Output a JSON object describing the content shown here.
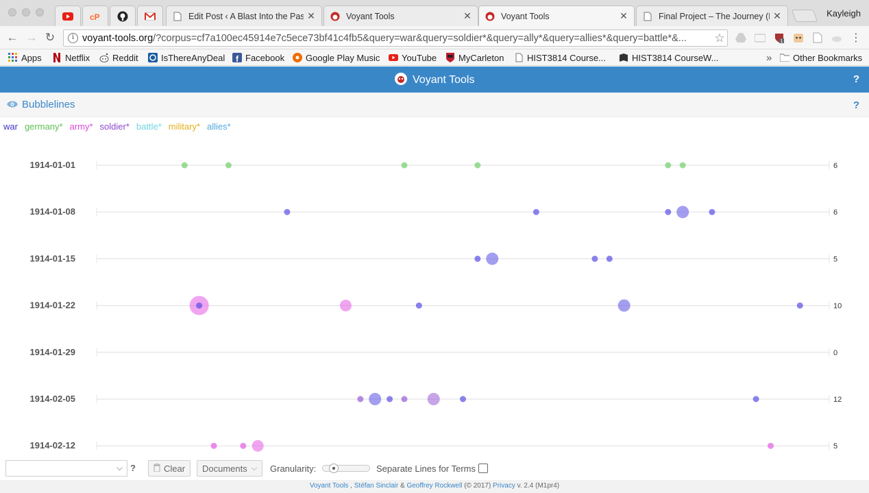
{
  "browser": {
    "tabs": [
      {
        "title": "",
        "favicon": "youtube-icon",
        "pinned": true
      },
      {
        "title": "",
        "favicon": "cpanel-icon",
        "pinned": true
      },
      {
        "title": "",
        "favicon": "github-icon",
        "pinned": true
      },
      {
        "title": "",
        "favicon": "gmail-icon",
        "pinned": true
      },
      {
        "title": "Edit Post ‹ A Blast Into the Pas",
        "favicon": "page-icon",
        "pinned": false
      },
      {
        "title": "Voyant Tools",
        "favicon": "voyant-icon",
        "pinned": false
      },
      {
        "title": "Voyant Tools",
        "favicon": "voyant-icon",
        "pinned": false,
        "active": true
      },
      {
        "title": "Final Project – The Journey (No",
        "favicon": "page-icon",
        "pinned": false
      }
    ],
    "profile_name": "Kayleigh",
    "url_domain": "voyant-tools.org",
    "url_rest": "/?corpus=cf7a100ec45914e7c5ece73bf41c4fb5&query=war&query=soldier*&query=ally*&query=allies*&query=battle*&..."
  },
  "bookmarks": [
    {
      "label": "Apps",
      "icon": "apps-grid-icon"
    },
    {
      "label": "Netflix",
      "icon": "netflix-icon"
    },
    {
      "label": "Reddit",
      "icon": "reddit-icon"
    },
    {
      "label": "IsThereAnyDeal",
      "icon": "isthereanydeal-icon"
    },
    {
      "label": "Facebook",
      "icon": "facebook-icon"
    },
    {
      "label": "Google Play Music",
      "icon": "play-music-icon"
    },
    {
      "label": "YouTube",
      "icon": "youtube-icon"
    },
    {
      "label": "MyCarleton",
      "icon": "carleton-icon"
    },
    {
      "label": "HIST3814 Course...",
      "icon": "page-icon"
    },
    {
      "label": "HIST3814 CourseW...",
      "icon": "book-icon"
    }
  ],
  "bookmarks_overflow": "»",
  "other_bookmarks": "Other Bookmarks",
  "app": {
    "title": "Voyant Tools",
    "help": "?"
  },
  "panel": {
    "title": "Bubblelines",
    "help": "?"
  },
  "colors": {
    "header_blue": "#3a87c8",
    "war": "#5a4ee6",
    "germany": "#72cf6b",
    "army": "#e45be4",
    "soldier": "#9a5ad6",
    "battle": "#7fe0ee",
    "military": "#e7b71f",
    "allies": "#5cb6e6"
  },
  "legend": [
    {
      "term": "war",
      "color": "#3f32c8"
    },
    {
      "term": "germany*",
      "color": "#5dbf55"
    },
    {
      "term": "army*",
      "color": "#d84bd8"
    },
    {
      "term": "soldier*",
      "color": "#8e49cc"
    },
    {
      "term": "battle*",
      "color": "#6fd6e6"
    },
    {
      "term": "military*",
      "color": "#e2b01a"
    },
    {
      "term": "allies*",
      "color": "#4fa9dc"
    }
  ],
  "chart_data": {
    "type": "scatter",
    "description_note": "",
    "documents": [
      {
        "label": "1914-01-01",
        "count": "6",
        "bubbles": [
          {
            "pos": 0.12,
            "term": "germany*",
            "r": 4.5
          },
          {
            "pos": 0.18,
            "term": "germany*",
            "r": 4.5
          },
          {
            "pos": 0.42,
            "term": "germany*",
            "r": 4.5
          },
          {
            "pos": 0.52,
            "term": "germany*",
            "r": 4.5
          },
          {
            "pos": 0.78,
            "term": "germany*",
            "r": 4.5
          },
          {
            "pos": 0.8,
            "term": "germany*",
            "r": 4.5
          }
        ]
      },
      {
        "label": "1914-01-08",
        "count": "6",
        "bubbles": [
          {
            "pos": 0.26,
            "term": "war",
            "r": 4.5
          },
          {
            "pos": 0.6,
            "term": "war",
            "r": 4.5
          },
          {
            "pos": 0.78,
            "term": "war",
            "r": 4.5
          },
          {
            "pos": 0.8,
            "term": "war",
            "r": 9
          },
          {
            "pos": 0.84,
            "term": "war",
            "r": 4.5
          }
        ]
      },
      {
        "label": "1914-01-15",
        "count": "5",
        "bubbles": [
          {
            "pos": 0.52,
            "term": "war",
            "r": 4.5
          },
          {
            "pos": 0.54,
            "term": "war",
            "r": 9
          },
          {
            "pos": 0.68,
            "term": "war",
            "r": 4.5
          },
          {
            "pos": 0.7,
            "term": "war",
            "r": 4.5
          }
        ]
      },
      {
        "label": "1914-01-22",
        "count": "10",
        "bubbles": [
          {
            "pos": 0.14,
            "term": "army*",
            "r": 14
          },
          {
            "pos": 0.14,
            "term": "war",
            "r": 4.5
          },
          {
            "pos": 0.34,
            "term": "army*",
            "r": 8.5
          },
          {
            "pos": 0.44,
            "term": "war",
            "r": 4.5
          },
          {
            "pos": 0.72,
            "term": "war",
            "r": 9
          },
          {
            "pos": 0.96,
            "term": "war",
            "r": 4.5
          }
        ]
      },
      {
        "label": "1914-01-29",
        "count": "0",
        "bubbles": []
      },
      {
        "label": "1914-02-05",
        "count": "12",
        "bubbles": [
          {
            "pos": 0.36,
            "term": "soldier*",
            "r": 4.5
          },
          {
            "pos": 0.38,
            "term": "war",
            "r": 9
          },
          {
            "pos": 0.4,
            "term": "war",
            "r": 4.5
          },
          {
            "pos": 0.42,
            "term": "soldier*",
            "r": 4.5
          },
          {
            "pos": 0.46,
            "term": "soldier*",
            "r": 9
          },
          {
            "pos": 0.5,
            "term": "war",
            "r": 4.5
          },
          {
            "pos": 0.9,
            "term": "war",
            "r": 4.5
          }
        ]
      },
      {
        "label": "1914-02-12",
        "count": "5",
        "bubbles": [
          {
            "pos": 0.16,
            "term": "army*",
            "r": 4.5
          },
          {
            "pos": 0.2,
            "term": "army*",
            "r": 4.5
          },
          {
            "pos": 0.22,
            "term": "army*",
            "r": 8.5
          },
          {
            "pos": 0.92,
            "term": "army*",
            "r": 4.5
          }
        ]
      }
    ]
  },
  "bottom_toolbar": {
    "query_value": "",
    "query_help": "?",
    "clear_label": "Clear",
    "documents_label": "Documents",
    "granularity_label": "Granularity:",
    "granularity_value": 0.1,
    "separate_lines_label": "Separate Lines for Terms",
    "separate_lines_checked": false
  },
  "footer": {
    "link1": "Voyant Tools",
    "sep1": " , ",
    "link2": "Stéfan Sinclair",
    "sep2": " & ",
    "link3": "Geoffrey Rockwell",
    "mid": " (© 2017) ",
    "link4": "Privacy",
    "version": " v. 2.4 (M1pr4)"
  }
}
